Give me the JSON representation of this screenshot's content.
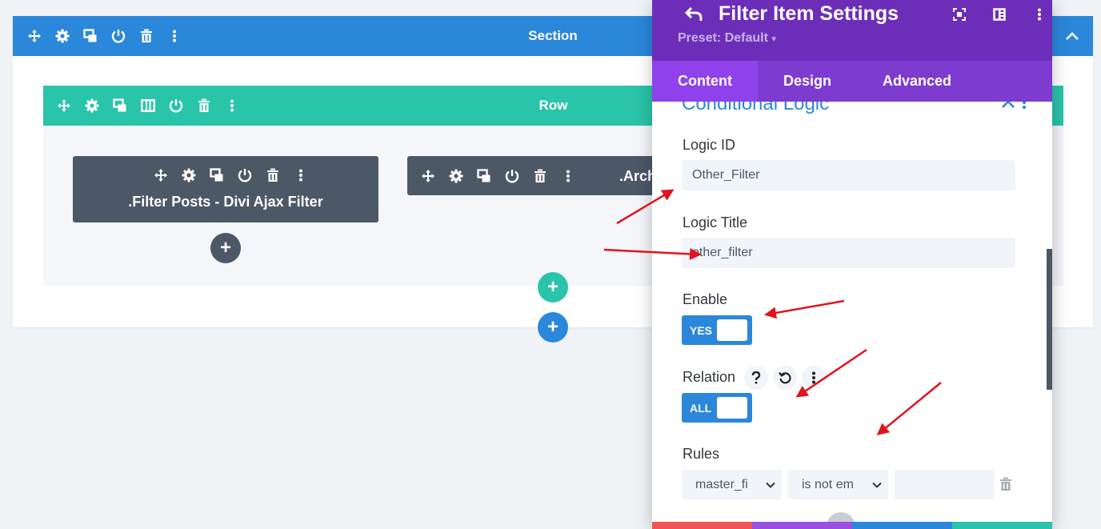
{
  "builder": {
    "section": {
      "title": "Section"
    },
    "row": {
      "title": "Row"
    },
    "modules": [
      {
        "title": ".Filter Posts - Divi Ajax Filter"
      },
      {
        "title": ".Arch"
      }
    ],
    "add_button_glyph": "+"
  },
  "panel": {
    "title": "Filter Item Settings",
    "preset": "Preset: Default",
    "tabs": [
      {
        "label": "Content",
        "active": true
      },
      {
        "label": "Design",
        "active": false
      },
      {
        "label": "Advanced",
        "active": false
      }
    ],
    "group_title": "Conditional Logic",
    "fields": {
      "logic_id": {
        "label": "Logic ID",
        "value": "Other_Filter"
      },
      "logic_title": {
        "label": "Logic Title",
        "value": "other_filter"
      },
      "enable": {
        "label": "Enable",
        "value": "YES"
      },
      "relation": {
        "label": "Relation",
        "value": "ALL"
      },
      "rules": {
        "label": "Rules",
        "field_value": "master_fi",
        "operator_value": "is not em",
        "value": ""
      }
    },
    "footer_colors": [
      "#ef5555",
      "#9b51e0",
      "#2b87da",
      "#29c4a9"
    ]
  },
  "colors": {
    "section": "#2b87da",
    "row": "#29c4a9",
    "module": "#4c5866",
    "panel_header": "#6c2eb9",
    "tabs": "#7e3bd0",
    "tab_active": "#8f42ec",
    "annotation_arrow": "#e0141e"
  },
  "icons": {
    "toolbar": [
      "move-icon",
      "gear-icon",
      "duplicate-icon",
      "power-icon",
      "trash-icon",
      "more-vertical-icon"
    ],
    "row_toolbar": [
      "move-icon",
      "gear-icon",
      "duplicate-icon",
      "columns-icon",
      "power-icon",
      "trash-icon",
      "more-vertical-icon"
    ],
    "panel_header": [
      "undo-icon",
      "expand-icon",
      "split-view-icon",
      "more-vertical-icon"
    ],
    "relation": [
      "help-icon",
      "reset-icon",
      "more-vertical-icon"
    ]
  }
}
